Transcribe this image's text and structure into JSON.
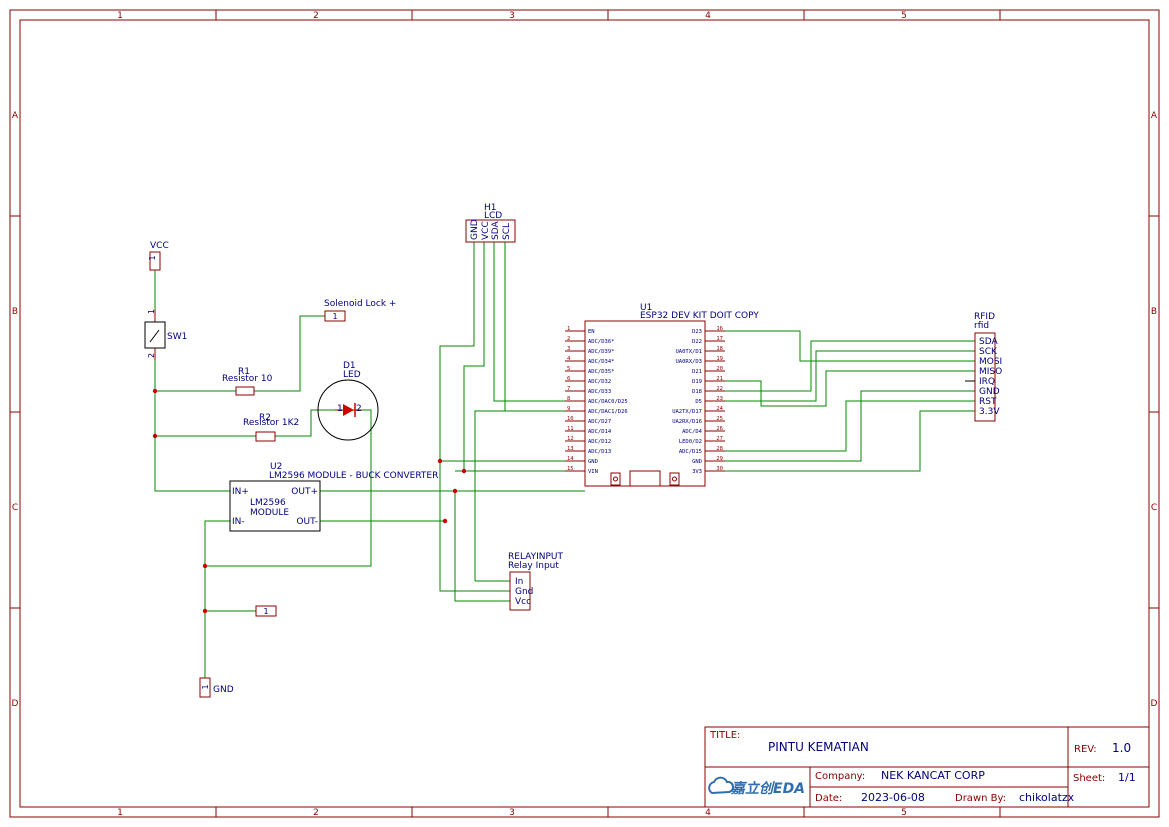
{
  "frame": {
    "col_labels": [
      "1",
      "2",
      "3",
      "4",
      "5"
    ],
    "row_labels": [
      "A",
      "B",
      "C",
      "D"
    ]
  },
  "components": {
    "vcc": {
      "label": "VCC",
      "pin": "1"
    },
    "gnd": {
      "label": "GND",
      "pin": "1"
    },
    "sw1": {
      "ref": "SW1",
      "pin1": "1",
      "pin2": "2"
    },
    "solenoid": {
      "label": "Solenoid Lock +",
      "pin": "1"
    },
    "r1": {
      "ref": "R1",
      "value": "Resistor 10"
    },
    "r2": {
      "ref": "R2",
      "value": "Resistor 1K2"
    },
    "d1": {
      "ref": "D1",
      "value": "LED",
      "pin1": "1",
      "pin2": "2"
    },
    "u2": {
      "ref": "U2",
      "value": "LM2596 MODULE - BUCK CONVERTER",
      "body_line1": "LM2596",
      "body_line2": "MODULE",
      "pins": {
        "in_plus": "IN+",
        "in_minus": "IN-",
        "out_plus": "OUT+",
        "out_minus": "OUT-"
      }
    },
    "header1": {
      "pin": "1"
    },
    "h1": {
      "ref": "H1",
      "value": "LCD",
      "pins": [
        "GND",
        "VCC",
        "SDA",
        "SCL"
      ]
    },
    "u1": {
      "ref": "U1",
      "value": "ESP32 DEV KIT DOIT COPY",
      "left_pins": [
        {
          "num": "1",
          "name": "EN"
        },
        {
          "num": "2",
          "name": "ADC/D36*"
        },
        {
          "num": "3",
          "name": "ADC/D39*"
        },
        {
          "num": "4",
          "name": "ADC/D34*"
        },
        {
          "num": "5",
          "name": "ADC/D35*"
        },
        {
          "num": "6",
          "name": "ADC/D32"
        },
        {
          "num": "7",
          "name": "ADC/D33"
        },
        {
          "num": "8",
          "name": "ADC/DAC0/D25"
        },
        {
          "num": "9",
          "name": "ADC/DAC1/D26"
        },
        {
          "num": "10",
          "name": "ADC/D27"
        },
        {
          "num": "11",
          "name": "ADC/D14"
        },
        {
          "num": "12",
          "name": "ADC/D12"
        },
        {
          "num": "13",
          "name": "ADC/D13"
        },
        {
          "num": "14",
          "name": "GND"
        },
        {
          "num": "15",
          "name": "VIN"
        }
      ],
      "right_pins": [
        {
          "num": "16",
          "name": "D23"
        },
        {
          "num": "17",
          "name": "D22"
        },
        {
          "num": "18",
          "name": "UA0TX/D1"
        },
        {
          "num": "19",
          "name": "UA0RX/D3"
        },
        {
          "num": "20",
          "name": "D21"
        },
        {
          "num": "21",
          "name": "D19"
        },
        {
          "num": "22",
          "name": "D18"
        },
        {
          "num": "23",
          "name": "D5"
        },
        {
          "num": "24",
          "name": "UA2TX/D17"
        },
        {
          "num": "25",
          "name": "UA2RX/D16"
        },
        {
          "num": "26",
          "name": "ADC/D4"
        },
        {
          "num": "27",
          "name": "LED0/D2"
        },
        {
          "num": "28",
          "name": "ADC/D15"
        },
        {
          "num": "29",
          "name": "GND"
        },
        {
          "num": "30",
          "name": "3V3"
        }
      ]
    },
    "rfid": {
      "ref": "RFID",
      "value": "rfid",
      "pins": [
        "SDA",
        "SCK",
        "MOSI",
        "MISO",
        "IRQ",
        "GND",
        "RST",
        "3.3V"
      ]
    },
    "relay": {
      "ref": "RELAYINPUT",
      "value": "Relay Input",
      "pins": [
        "In",
        "Gnd",
        "Vcc"
      ]
    }
  },
  "title_block": {
    "title_label": "TITLE:",
    "title": "PINTU KEMATIAN",
    "rev_label": "REV:",
    "rev": "1.0",
    "company_label": "Company:",
    "company": "NEK KANCAT CORP",
    "sheet_label": "Sheet:",
    "sheet": "1/1",
    "date_label": "Date:",
    "date": "2023-06-08",
    "drawn_label": "Drawn By:",
    "drawn_by": "chikolatzx",
    "logo_text": "嘉立创EDA"
  },
  "colors": {
    "frame": "#8b0000",
    "wire": "#008800",
    "label": "#000080",
    "junction": "#cc0000",
    "logo": "#2f6fb0"
  }
}
